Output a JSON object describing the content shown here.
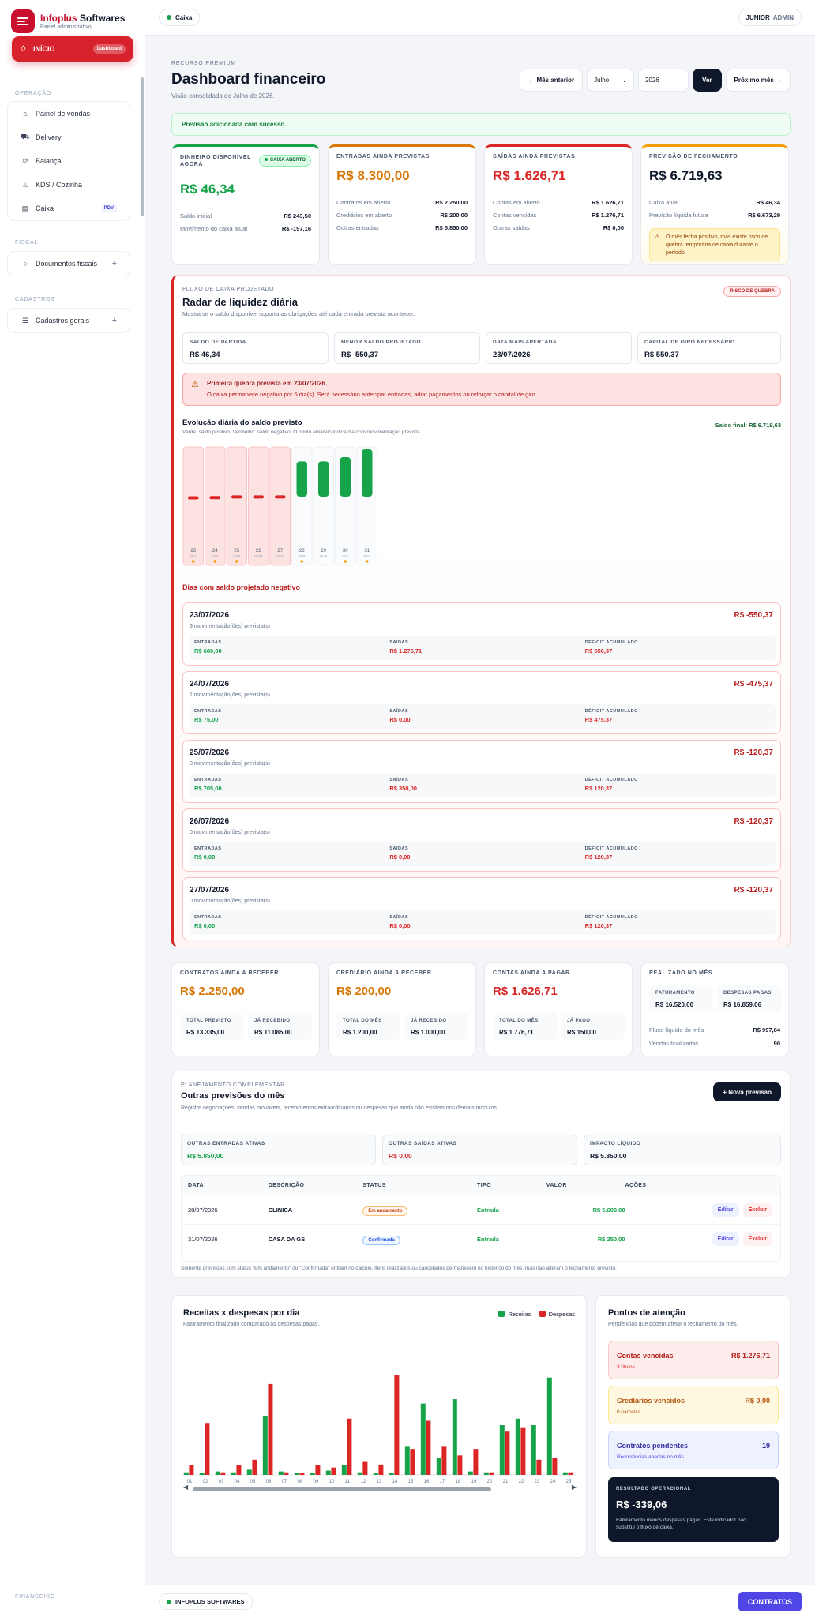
{
  "brand": {
    "title_a": "Infoplus",
    "title_b": "Softwares",
    "subtitle": "Painel administrativo"
  },
  "sidebar": {
    "home": {
      "label": "INÍCIO",
      "badge": "Dashboard"
    },
    "sections": [
      {
        "label": "OPERAÇÃO"
      },
      {
        "label": "FISCAL"
      },
      {
        "label": "CADASTROS"
      },
      {
        "label": "FINANCEIRO"
      }
    ],
    "operacao": [
      {
        "label": "Painel de vendas",
        "icon": "store-icon"
      },
      {
        "label": "Delivery",
        "icon": "truck-icon"
      },
      {
        "label": "Balança",
        "icon": "scale-icon"
      },
      {
        "label": "KDS / Cozinha",
        "icon": "kitchen-icon"
      },
      {
        "label": "Caixa",
        "icon": "cash-register-icon",
        "badge": "PDV"
      }
    ],
    "fiscal": [
      {
        "label": "Documentos fiscais",
        "icon": "document-icon"
      }
    ],
    "cadastros": [
      {
        "label": "Cadastros gerais",
        "icon": "list-icon"
      }
    ]
  },
  "topbar": {
    "caixa": "Caixa",
    "user": "JUNIOR",
    "role": "ADMIN"
  },
  "header": {
    "tag": "RECURSO PREMIUM",
    "title": "Dashboard financeiro",
    "subtitle": "Visão consolidada de Julho de 2026.",
    "prev": "← Mês anterior",
    "month": "Julho",
    "year": "2026",
    "ver": "Ver",
    "next": "Próximo mês →"
  },
  "success": "Previsão adicionada com sucesso.",
  "kpis": [
    {
      "label": "DINHEIRO DISPONÍVEL AGORA",
      "value": "R$ 46,34",
      "pill": "CAIXA ABERTO",
      "rows": [
        {
          "k": "Saldo inicial",
          "v": "R$ 243,50"
        },
        {
          "k": "Movimento do caixa atual",
          "v": "R$ -197,16"
        }
      ]
    },
    {
      "label": "ENTRADAS AINDA PREVISTAS",
      "value": "R$ 8.300,00",
      "rows": [
        {
          "k": "Contratos em aberto",
          "v": "R$ 2.250,00"
        },
        {
          "k": "Crediários em aberto",
          "v": "R$ 200,00"
        },
        {
          "k": "Outras entradas",
          "v": "R$ 5.850,00"
        }
      ]
    },
    {
      "label": "SAÍDAS AINDA PREVISTAS",
      "value": "R$ 1.626,71",
      "rows": [
        {
          "k": "Contas em aberto",
          "v": "R$ 1.626,71"
        },
        {
          "k": "Contas vencidas",
          "v": "R$ 1.276,71"
        },
        {
          "k": "Outras saídas",
          "v": "R$ 0,00"
        }
      ]
    },
    {
      "label": "PREVISÃO DE FECHAMENTO",
      "value": "R$ 6.719,63",
      "rows": [
        {
          "k": "Caixa atual",
          "v": "R$ 46,34"
        },
        {
          "k": "Previsão líquida futura",
          "v": "R$ 6.673,29"
        }
      ],
      "warn": "O mês fecha positivo, mas existe risco de quebra temporária de caixa durante o período."
    }
  ],
  "radar": {
    "tag": "FLUXO DE CAIXA PROJETADO",
    "title": "Radar de liquidez diária",
    "subtitle": "Mostra se o saldo disponível suporta as obrigações até cada entrada prevista acontecer.",
    "risk": "RISCO DE QUEBRA",
    "stats": [
      {
        "label": "SALDO DE PARTIDA",
        "value": "R$ 46,34"
      },
      {
        "label": "MENOR SALDO PROJETADO",
        "value": "R$ -550,37"
      },
      {
        "label": "DATA MAIS APERTADA",
        "value": "23/07/2026"
      },
      {
        "label": "CAPITAL DE GIRO NECESSÁRIO",
        "value": "R$ 550,37"
      }
    ],
    "alert_title": "Primeira quebra prevista em 23/07/2026.",
    "alert_desc": "O caixa permanece negativo por 5 dia(s). Será necessário antecipar entradas, adiar pagamentos ou reforçar o capital de giro.",
    "evo_title": "Evolução diária do saldo previsto",
    "evo_sub": "Verde: saldo positivo. Vermelho: saldo negativo. O ponto amarelo indica dia com movimentação prevista.",
    "final": "Saldo final: R$ 6.719,63",
    "neg_title": "Dias com saldo projetado negativo",
    "col_labels": {
      "in": "ENTRADAS",
      "out": "SAÍDAS",
      "def": "DÉFICIT ACUMULADO"
    },
    "days": [
      {
        "date": "23/07/2026",
        "mov": "9 movimentação(ões) prevista(s)",
        "total": "R$ -550,37",
        "in": "R$ 680,00",
        "out": "R$ 1.276,71",
        "def": "R$ 550,37"
      },
      {
        "date": "24/07/2026",
        "mov": "1 movimentação(ões) prevista(s)",
        "total": "R$ -475,37",
        "in": "R$ 75,00",
        "out": "R$ 0,00",
        "def": "R$ 475,37"
      },
      {
        "date": "25/07/2026",
        "mov": "8 movimentação(ões) prevista(s)",
        "total": "R$ -120,37",
        "in": "R$ 705,00",
        "out": "R$ 350,00",
        "def": "R$ 120,37"
      },
      {
        "date": "26/07/2026",
        "mov": "0 movimentação(ões) prevista(s)",
        "total": "R$ -120,37",
        "in": "R$ 0,00",
        "out": "R$ 0,00",
        "def": "R$ 120,37"
      },
      {
        "date": "27/07/2026",
        "mov": "0 movimentação(ões) prevista(s)",
        "total": "R$ -120,37",
        "in": "R$ 0,00",
        "out": "R$ 0,00",
        "def": "R$ 120,37"
      }
    ],
    "daily_bars": [
      {
        "day": "23",
        "dow": "QUI",
        "balance": -550.37,
        "moves": true
      },
      {
        "day": "24",
        "dow": "SEX",
        "balance": -475.37,
        "moves": true
      },
      {
        "day": "25",
        "dow": "SÁB",
        "balance": -120.37,
        "moves": true
      },
      {
        "day": "26",
        "dow": "DOM",
        "balance": -120.37,
        "moves": false
      },
      {
        "day": "27",
        "dow": "SEG",
        "balance": -120.37,
        "moves": false
      },
      {
        "day": "28",
        "dow": "TER",
        "balance": 5000,
        "moves": true
      },
      {
        "day": "29",
        "dow": "QUA",
        "balance": 5000,
        "moves": false
      },
      {
        "day": "30",
        "dow": "QUI",
        "balance": 5600,
        "moves": true
      },
      {
        "day": "31",
        "dow": "SEX",
        "balance": 6719.63,
        "moves": true
      }
    ]
  },
  "summary": [
    {
      "label": "CONTRATOS AINDA A RECEBER",
      "value": "R$ 2.250,00",
      "a_l": "TOTAL PREVISTO",
      "a_v": "R$ 13.335,00",
      "b_l": "JÁ RECEBIDO",
      "b_v": "R$ 11.085,00"
    },
    {
      "label": "CREDIÁRIO AINDA A RECEBER",
      "value": "R$ 200,00",
      "a_l": "TOTAL DO MÊS",
      "a_v": "R$ 1.200,00",
      "b_l": "JÁ RECEBIDO",
      "b_v": "R$ 1.000,00"
    },
    {
      "label": "CONTAS AINDA A PAGAR",
      "value": "R$ 1.626,71",
      "a_l": "TOTAL DO MÊS",
      "a_v": "R$ 1.776,71",
      "b_l": "JÁ PAGO",
      "b_v": "R$ 150,00"
    },
    {
      "label": "REALIZADO NO MÊS",
      "a_l": "FATURAMENTO",
      "a_v": "R$ 16.520,00",
      "b_l": "DESPESAS PAGAS",
      "b_v": "R$ 16.859,06",
      "rows": [
        {
          "k": "Fluxo líquido do mês",
          "v": "R$ 997,84"
        },
        {
          "k": "Vendas finalizadas",
          "v": "90"
        }
      ]
    }
  ],
  "plan": {
    "tag": "PLANEJAMENTO COMPLEMENTAR",
    "title": "Outras previsões do mês",
    "subtitle": "Registre negociações, vendas prováveis, recebimentos extraordinários ou despesas que ainda não existem nos demais módulos.",
    "new_btn": "+ Nova previsão",
    "boxes": [
      {
        "label": "OUTRAS ENTRADAS ATIVAS",
        "value": "R$ 5.850,00"
      },
      {
        "label": "OUTRAS SAÍDAS ATIVAS",
        "value": "R$ 0,00"
      },
      {
        "label": "IMPACTO LÍQUIDO",
        "value": "R$ 5.850,00"
      }
    ],
    "headers": [
      "DATA",
      "DESCRIÇÃO",
      "STATUS",
      "TIPO",
      "VALOR",
      "AÇÕES"
    ],
    "rows": [
      {
        "date": "28/07/2026",
        "desc": "CLINICA",
        "status": "Em andamento",
        "tipo": "Entrada",
        "valor": "R$ 5.600,00"
      },
      {
        "date": "31/07/2026",
        "desc": "CASA DA GS",
        "status": "Confirmada",
        "tipo": "Entrada",
        "valor": "R$ 250,00"
      }
    ],
    "edit": "Editar",
    "del": "Excluir",
    "footnote": "Somente previsões com status \"Em andamento\" ou \"Confirmada\" entram no cálculo. Itens realizados ou cancelados permanecem no histórico do mês, mas não alteram o fechamento previsto."
  },
  "chart_card": {
    "title": "Receitas x despesas por dia",
    "subtitle": "Faturamento finalizado comparado às despesas pagas."
  },
  "chart_data": {
    "type": "bar",
    "categories": [
      "01",
      "02",
      "03",
      "04",
      "05",
      "06",
      "07",
      "08",
      "09",
      "10",
      "11",
      "12",
      "13",
      "14",
      "15",
      "16",
      "17",
      "18",
      "19",
      "20",
      "21",
      "22",
      "23",
      "24",
      "25"
    ],
    "series": [
      {
        "name": "Receitas",
        "color": "#16a34a",
        "values": [
          60,
          40,
          80,
          60,
          120,
          1350,
          80,
          50,
          50,
          100,
          220,
          60,
          40,
          50,
          650,
          1650,
          400,
          1750,
          80,
          60,
          1150,
          1300,
          1150,
          2250,
          60
        ]
      },
      {
        "name": "Despesas",
        "color": "#dc2626",
        "values": [
          220,
          1200,
          60,
          220,
          350,
          2100,
          60,
          50,
          220,
          170,
          1300,
          300,
          240,
          2300,
          600,
          1250,
          650,
          450,
          600,
          60,
          1000,
          1100,
          350,
          400,
          60
        ]
      }
    ],
    "ylim": [
      0,
      2500
    ],
    "legend": "top-right"
  },
  "attention": {
    "title": "Pontos de atenção",
    "subtitle": "Pendências que podem afetar o fechamento do mês.",
    "items": [
      {
        "title": "Contas vencidas",
        "sub": "3 títulos",
        "value": "R$ 1.276,71"
      },
      {
        "title": "Crediários vencidos",
        "sub": "0 parcelas",
        "value": "R$ 0,00"
      },
      {
        "title": "Contratos pendentes",
        "sub": "Recorrências abertas no mês",
        "value": "19"
      }
    ],
    "result_label": "RESULTADO OPERACIONAL",
    "result_value": "R$ -339,06",
    "result_desc": "Faturamento menos despesas pagas. Este indicador não substitui o fluxo de caixa."
  },
  "footer": {
    "brand": "INFOPLUS SOFTWARES",
    "button": "CONTRATOS"
  }
}
